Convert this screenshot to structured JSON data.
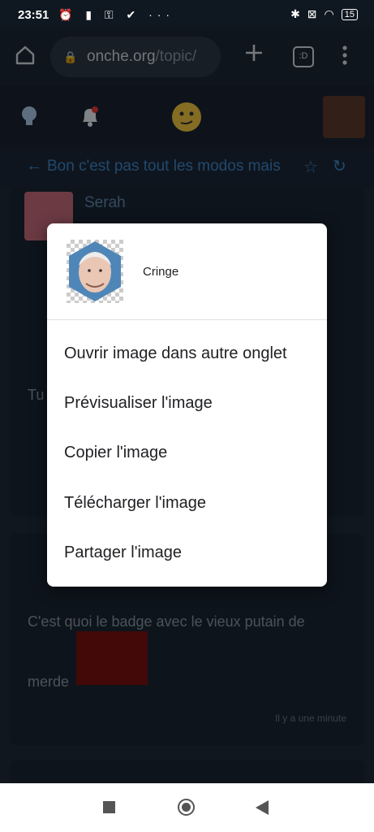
{
  "status_bar": {
    "time": "23:51",
    "battery": "15"
  },
  "browser": {
    "url_host": "onche.org",
    "url_path": "/topic/",
    "tab_count": ":D"
  },
  "topic": {
    "title": "Bon c'est pas tout les modos mais"
  },
  "post1": {
    "author": "Serah",
    "text": "Tu"
  },
  "post2": {
    "text_line1": "C'est quoi le badge avec le vieux putain de",
    "text_line2": "merde",
    "time": "Il y a une minute"
  },
  "context_menu": {
    "title": "Cringe",
    "items": [
      {
        "label": "Ouvrir image dans autre onglet"
      },
      {
        "label": "Prévisualiser l'image"
      },
      {
        "label": "Copier l'image"
      },
      {
        "label": "Télécharger l'image"
      },
      {
        "label": "Partager l'image"
      }
    ]
  }
}
